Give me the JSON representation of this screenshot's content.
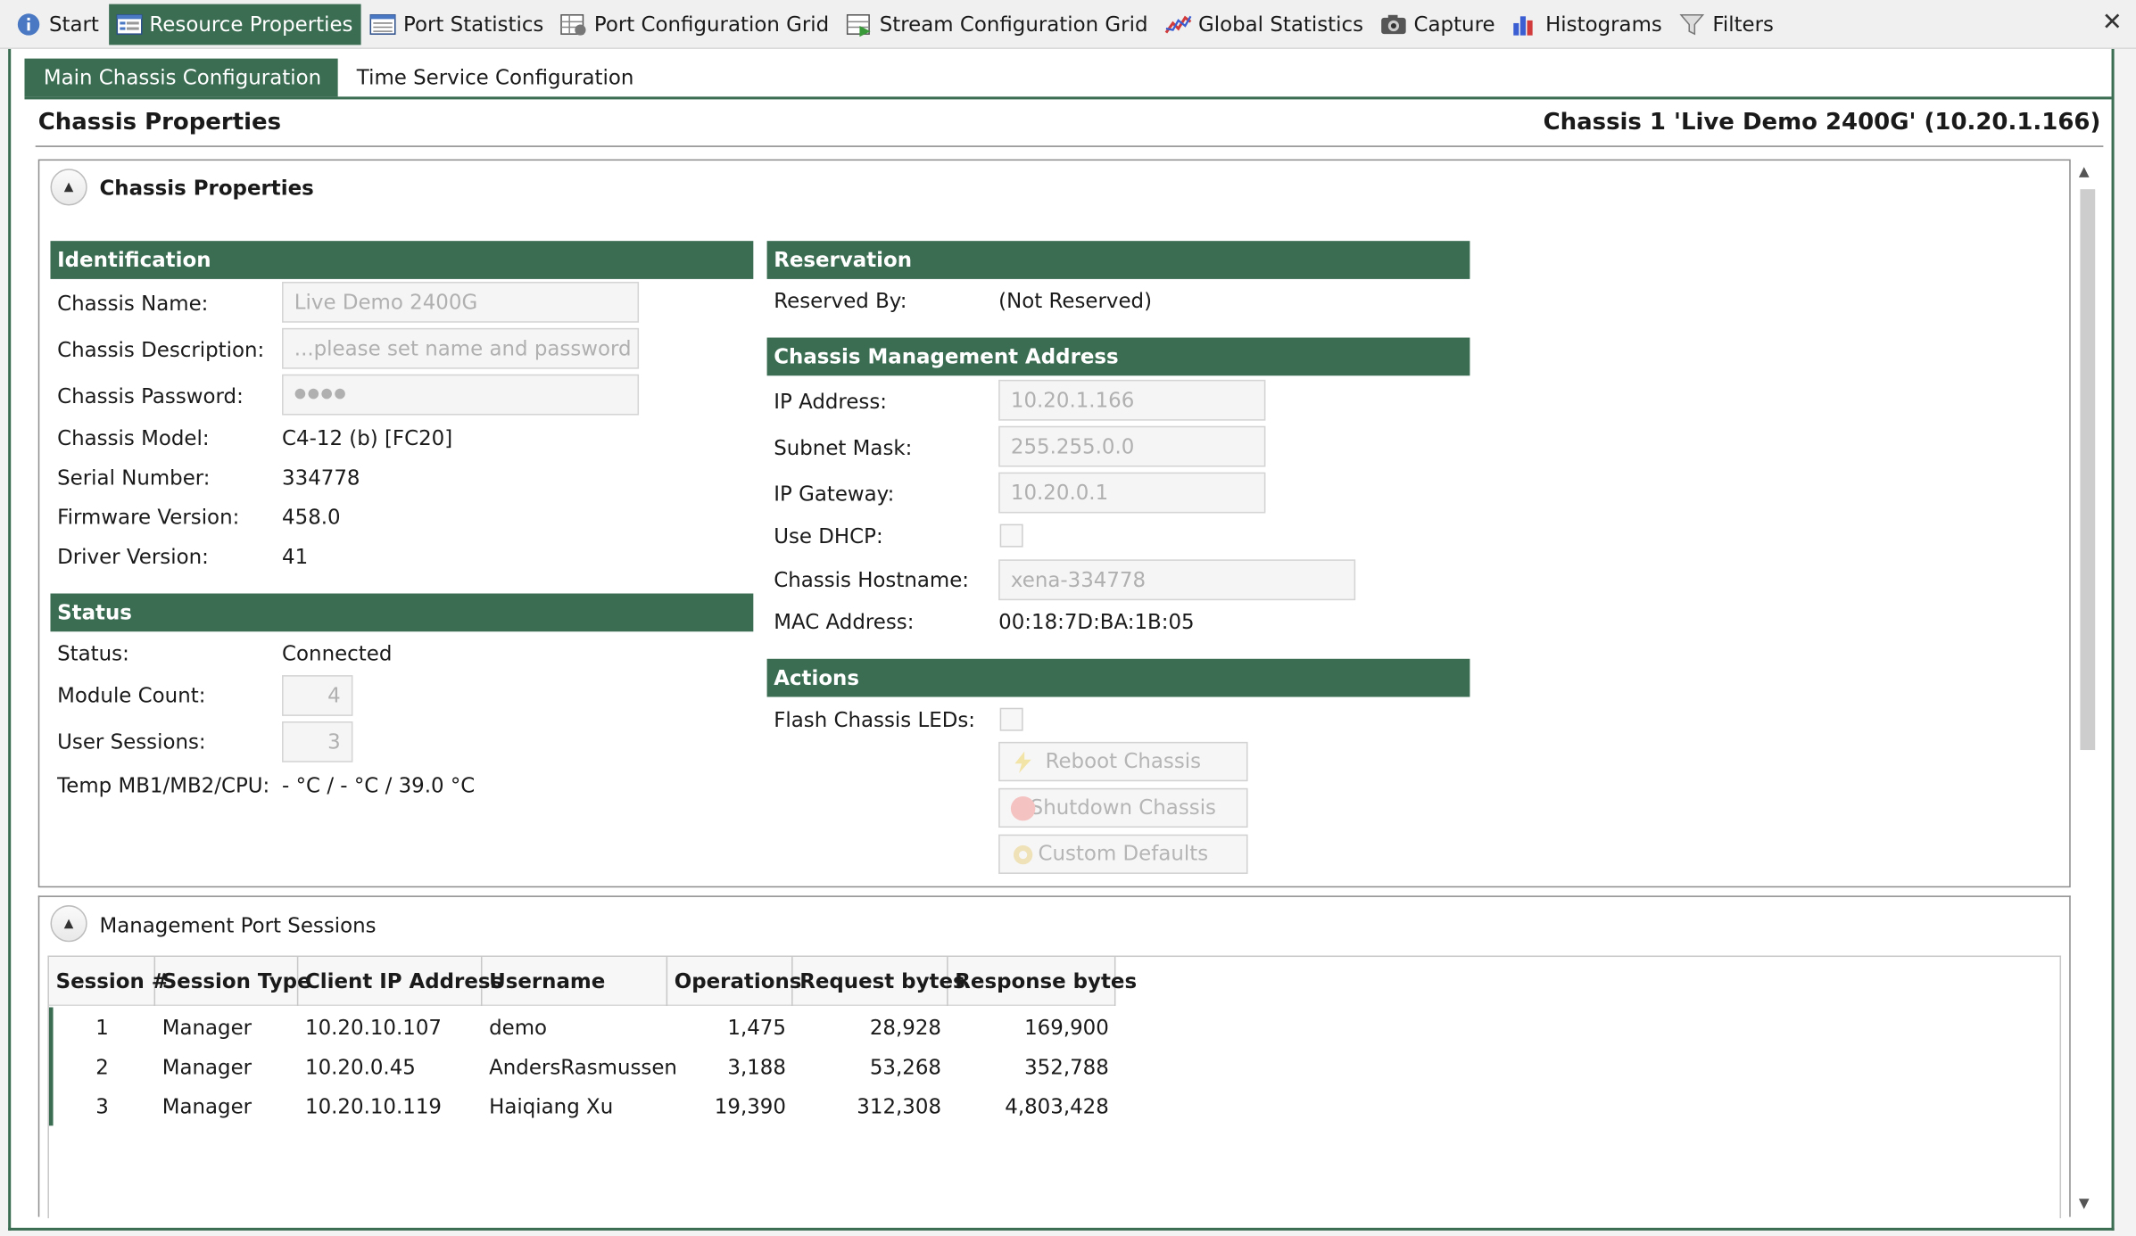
{
  "tabs": [
    {
      "label": "Start",
      "icon": "info-icon",
      "active": false
    },
    {
      "label": "Resource Properties",
      "icon": "properties-icon",
      "active": true
    },
    {
      "label": "Port Statistics",
      "icon": "statistics-icon",
      "active": false
    },
    {
      "label": "Port Configuration Grid",
      "icon": "grid-config-icon",
      "active": false
    },
    {
      "label": "Stream Configuration Grid",
      "icon": "stream-grid-icon",
      "active": false
    },
    {
      "label": "Global Statistics",
      "icon": "line-chart-icon",
      "active": false
    },
    {
      "label": "Capture",
      "icon": "camera-icon",
      "active": false
    },
    {
      "label": "Histograms",
      "icon": "bar-chart-icon",
      "active": false
    },
    {
      "label": "Filters",
      "icon": "filter-icon",
      "active": false
    }
  ],
  "close_label": "✕",
  "subtabs": [
    {
      "label": "Main Chassis Configuration",
      "active": true
    },
    {
      "label": "Time Service Configuration",
      "active": false
    }
  ],
  "header": {
    "title": "Chassis Properties",
    "chassis_id": "Chassis 1 'Live Demo 2400G' (10.20.1.166)"
  },
  "chassis_panel": {
    "title": "Chassis Properties",
    "identification": {
      "heading": "Identification",
      "name_label": "Chassis Name:",
      "name_value": "Live Demo 2400G",
      "description_label": "Chassis Description:",
      "description_value": "...please set name and password",
      "password_label": "Chassis Password:",
      "password_value": "●●●●",
      "model_label": "Chassis Model:",
      "model_value": "C4-12 (b) [FC20]",
      "serial_label": "Serial Number:",
      "serial_value": "334778",
      "firmware_label": "Firmware Version:",
      "firmware_value": "458.0",
      "driver_label": "Driver Version:",
      "driver_value": "41"
    },
    "status": {
      "heading": "Status",
      "status_label": "Status:",
      "status_value": "Connected",
      "module_count_label": "Module Count:",
      "module_count_value": "4",
      "user_sessions_label": "User Sessions:",
      "user_sessions_value": "3",
      "temp_label": "Temp MB1/MB2/CPU:",
      "temp_value": "- °C / - °C / 39.0 °C"
    },
    "reservation": {
      "heading": "Reservation",
      "reserved_by_label": "Reserved By:",
      "reserved_by_value": "(Not Reserved)"
    },
    "management_address": {
      "heading": "Chassis Management Address",
      "ip_label": "IP Address:",
      "ip_value": "10.20.1.166",
      "subnet_label": "Subnet Mask:",
      "subnet_value": "255.255.0.0",
      "gateway_label": "IP Gateway:",
      "gateway_value": "10.20.0.1",
      "dhcp_label": "Use DHCP:",
      "dhcp_checked": false,
      "hostname_label": "Chassis Hostname:",
      "hostname_value": "xena-334778",
      "mac_label": "MAC Address:",
      "mac_value": "00:18:7D:BA:1B:05"
    },
    "actions": {
      "heading": "Actions",
      "flash_label": "Flash Chassis LEDs:",
      "flash_checked": false,
      "reboot_label": "Reboot Chassis",
      "shutdown_label": "Shutdown Chassis",
      "defaults_label": "Custom Defaults"
    }
  },
  "sessions_panel": {
    "title": "Management Port Sessions",
    "columns": [
      "Session #",
      "Session Type",
      "Client IP Address",
      "Username",
      "Operations",
      "Request bytes",
      "Response bytes"
    ],
    "rows": [
      {
        "session": "1",
        "type": "Manager",
        "client_ip": "10.20.10.107",
        "username": "demo",
        "operations": "1,475",
        "request_bytes": "28,928",
        "response_bytes": "169,900"
      },
      {
        "session": "2",
        "type": "Manager",
        "client_ip": "10.20.0.45",
        "username": "AndersRasmussen",
        "operations": "3,188",
        "request_bytes": "53,268",
        "response_bytes": "352,788"
      },
      {
        "session": "3",
        "type": "Manager",
        "client_ip": "10.20.10.119",
        "username": "Haiqiang Xu",
        "operations": "19,390",
        "request_bytes": "312,308",
        "response_bytes": "4,803,428"
      }
    ]
  },
  "colors": {
    "accent": "#3b6d53",
    "disabled_text": "#b0b0b0"
  }
}
